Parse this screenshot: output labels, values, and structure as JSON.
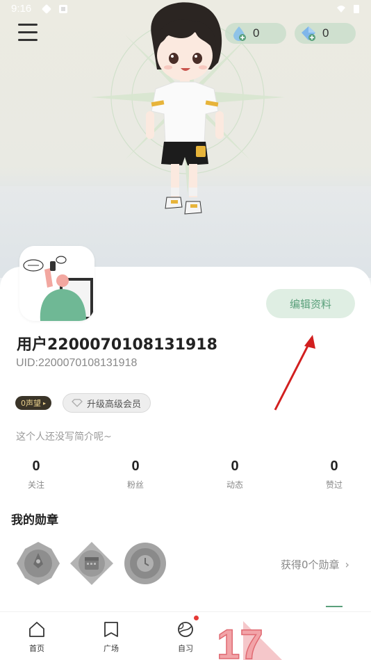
{
  "status_bar": {
    "time": "9:16"
  },
  "header": {
    "menu_icon": "hamburger-menu-icon",
    "currencies": [
      {
        "icon": "water-drop-coin-icon",
        "value": "0"
      },
      {
        "icon": "diamond-coin-icon",
        "value": "0"
      }
    ]
  },
  "profile": {
    "edit_label": "编辑资料",
    "username": "用户2200070108131918",
    "uid": "UID:2200070108131918",
    "repute_badge": "0声望",
    "vip_label": "升级高级会员",
    "bio": "这个人还没写简介呢~"
  },
  "stats": [
    {
      "value": "0",
      "label": "关注"
    },
    {
      "value": "0",
      "label": "粉丝"
    },
    {
      "value": "0",
      "label": "动态"
    },
    {
      "value": "0",
      "label": "赞过"
    }
  ],
  "medals": {
    "title": "我的勋章",
    "link": "获得0个勋章",
    "items": [
      "rocket-medal-icon",
      "calendar-medal-icon",
      "clock-medal-icon"
    ]
  },
  "bottom_nav": [
    {
      "label": "首页",
      "icon": "home-icon"
    },
    {
      "label": "广场",
      "icon": "book-icon"
    },
    {
      "label": "自习",
      "icon": "planet-icon"
    }
  ],
  "watermark": "17",
  "colors": {
    "accent": "#5aa07b",
    "edit_button_bg": "#dfeee3",
    "repute_bg": "#3a3428",
    "annotation_arrow": "#d21f1f"
  }
}
